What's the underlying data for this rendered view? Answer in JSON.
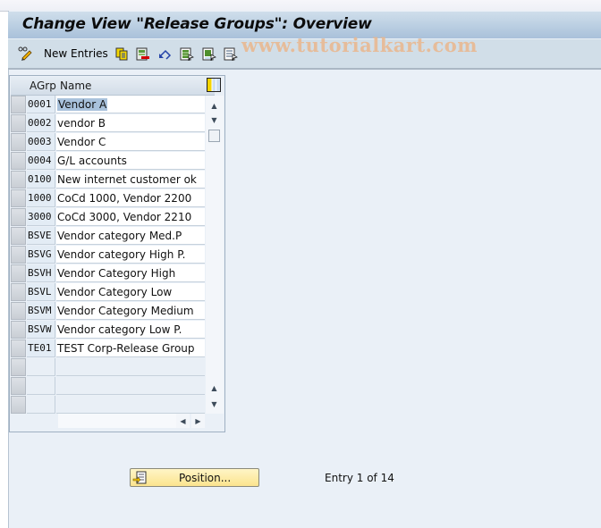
{
  "window": {
    "title": "Change View \"Release Groups\": Overview"
  },
  "toolbar": {
    "items": [
      {
        "icon": "pencil-glasses-icon",
        "label": ""
      },
      {
        "icon": "",
        "label": "New Entries"
      },
      {
        "icon": "copy-as-icon",
        "label": ""
      },
      {
        "icon": "delete-icon",
        "label": ""
      },
      {
        "icon": "undo-change-icon",
        "label": ""
      },
      {
        "icon": "select-all-icon",
        "label": ""
      },
      {
        "icon": "select-block-icon",
        "label": ""
      },
      {
        "icon": "deselect-all-icon",
        "label": ""
      }
    ],
    "watermark": "www.tutorialkart.com"
  },
  "table": {
    "columns": [
      "AGrp",
      "Name"
    ],
    "rows": [
      {
        "agrp": "0001",
        "name": "Vendor A",
        "selected": true
      },
      {
        "agrp": "0002",
        "name": "vendor B"
      },
      {
        "agrp": "0003",
        "name": "Vendor C"
      },
      {
        "agrp": "0004",
        "name": "G/L accounts"
      },
      {
        "agrp": "0100",
        "name": "New internet customer ok"
      },
      {
        "agrp": "1000",
        "name": "CoCd 1000, Vendor 2200"
      },
      {
        "agrp": "3000",
        "name": "CoCd 3000, Vendor 2210"
      },
      {
        "agrp": "BSVE",
        "name": "Vendor category Med.P"
      },
      {
        "agrp": "BSVG",
        "name": "Vendor category High P."
      },
      {
        "agrp": "BSVH",
        "name": "Vendor Category High"
      },
      {
        "agrp": "BSVL",
        "name": "Vendor Category Low"
      },
      {
        "agrp": "BSVM",
        "name": "Vendor Category Medium"
      },
      {
        "agrp": "BSVW",
        "name": "Vendor category Low P."
      },
      {
        "agrp": "TE01",
        "name": "TEST Corp-Release Group"
      },
      {
        "agrp": "",
        "name": ""
      },
      {
        "agrp": "",
        "name": ""
      },
      {
        "agrp": "",
        "name": ""
      }
    ],
    "column_config_icon": "table-settings-icon"
  },
  "footer": {
    "position_button": "Position...",
    "entry_info": "Entry 1 of 14"
  },
  "colors": {
    "title_bar": "#b9cee2",
    "toolbar": "#d1dee8",
    "background": "#eaf0f7",
    "selection": "#a9c2dc",
    "position_button": "#fbe48e"
  }
}
